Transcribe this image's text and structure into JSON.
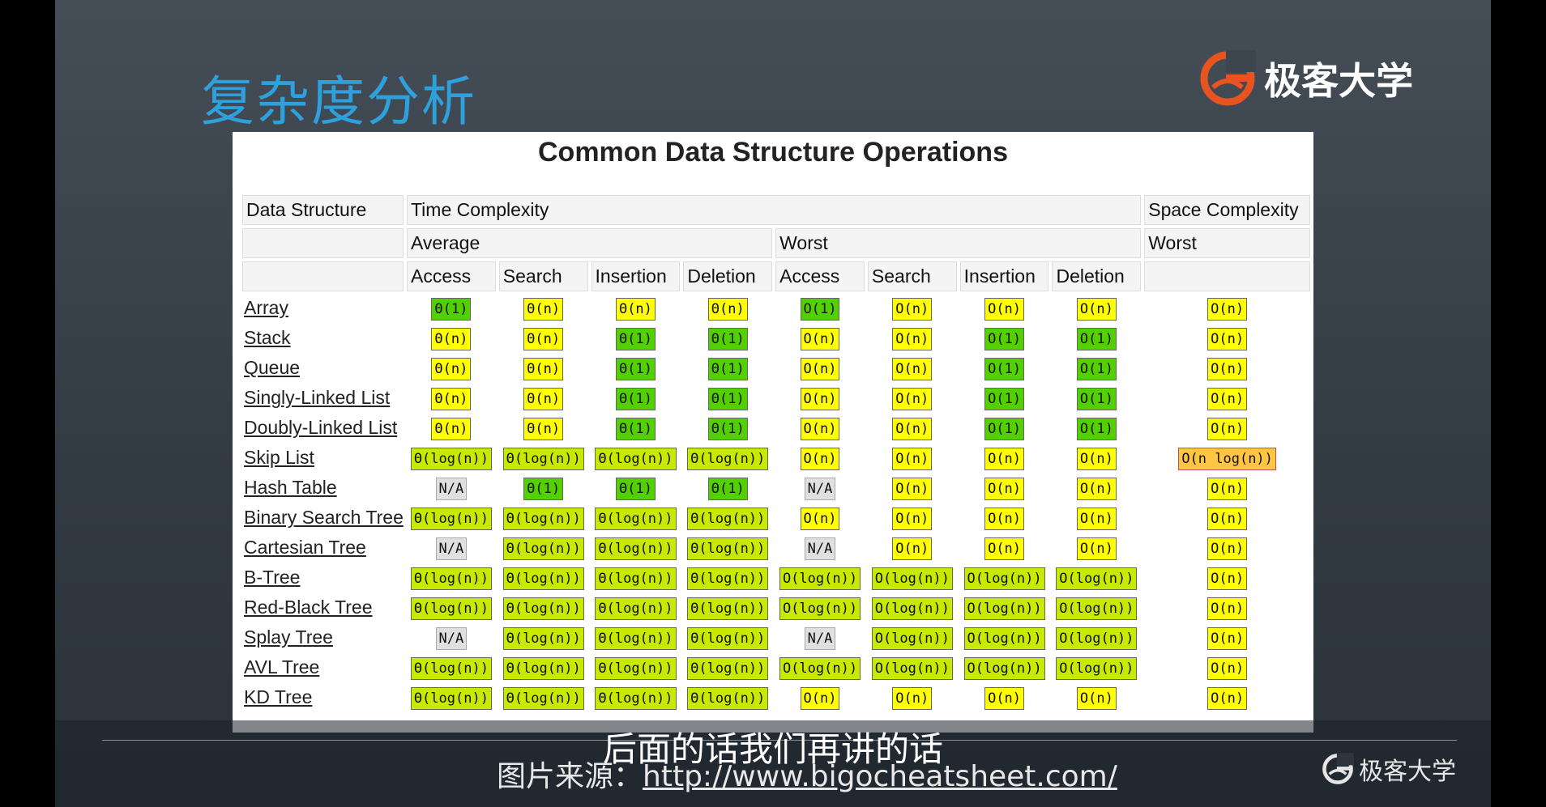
{
  "slide": {
    "title": "复杂度分析",
    "brand": "极客大学",
    "watermark": "极客大学",
    "subtitle": "后面的话我们再讲的话",
    "source_label": "图片来源：",
    "source_url": "http://www.bigocheatsheet.com/"
  },
  "table": {
    "title": "Common Data Structure Operations",
    "headers": {
      "data_structure": "Data Structure",
      "time_complexity": "Time Complexity",
      "space_complexity": "Space Complexity",
      "average": "Average",
      "worst": "Worst",
      "space_worst": "Worst",
      "ops": [
        "Access",
        "Search",
        "Insertion",
        "Deletion",
        "Access",
        "Search",
        "Insertion",
        "Deletion"
      ]
    },
    "rows": [
      {
        "name": "Array",
        "cells": [
          [
            "Θ(1)",
            "green"
          ],
          [
            "Θ(n)",
            "yellow"
          ],
          [
            "Θ(n)",
            "yellow"
          ],
          [
            "Θ(n)",
            "yellow"
          ],
          [
            "O(1)",
            "green"
          ],
          [
            "O(n)",
            "yellow"
          ],
          [
            "O(n)",
            "yellow"
          ],
          [
            "O(n)",
            "yellow"
          ],
          [
            "O(n)",
            "yellow"
          ]
        ]
      },
      {
        "name": "Stack",
        "cells": [
          [
            "Θ(n)",
            "yellow"
          ],
          [
            "Θ(n)",
            "yellow"
          ],
          [
            "Θ(1)",
            "green"
          ],
          [
            "Θ(1)",
            "green"
          ],
          [
            "O(n)",
            "yellow"
          ],
          [
            "O(n)",
            "yellow"
          ],
          [
            "O(1)",
            "green"
          ],
          [
            "O(1)",
            "green"
          ],
          [
            "O(n)",
            "yellow"
          ]
        ]
      },
      {
        "name": "Queue",
        "cells": [
          [
            "Θ(n)",
            "yellow"
          ],
          [
            "Θ(n)",
            "yellow"
          ],
          [
            "Θ(1)",
            "green"
          ],
          [
            "Θ(1)",
            "green"
          ],
          [
            "O(n)",
            "yellow"
          ],
          [
            "O(n)",
            "yellow"
          ],
          [
            "O(1)",
            "green"
          ],
          [
            "O(1)",
            "green"
          ],
          [
            "O(n)",
            "yellow"
          ]
        ]
      },
      {
        "name": "Singly-Linked List",
        "cells": [
          [
            "Θ(n)",
            "yellow"
          ],
          [
            "Θ(n)",
            "yellow"
          ],
          [
            "Θ(1)",
            "green"
          ],
          [
            "Θ(1)",
            "green"
          ],
          [
            "O(n)",
            "yellow"
          ],
          [
            "O(n)",
            "yellow"
          ],
          [
            "O(1)",
            "green"
          ],
          [
            "O(1)",
            "green"
          ],
          [
            "O(n)",
            "yellow"
          ]
        ]
      },
      {
        "name": "Doubly-Linked List",
        "cells": [
          [
            "Θ(n)",
            "yellow"
          ],
          [
            "Θ(n)",
            "yellow"
          ],
          [
            "Θ(1)",
            "green"
          ],
          [
            "Θ(1)",
            "green"
          ],
          [
            "O(n)",
            "yellow"
          ],
          [
            "O(n)",
            "yellow"
          ],
          [
            "O(1)",
            "green"
          ],
          [
            "O(1)",
            "green"
          ],
          [
            "O(n)",
            "yellow"
          ]
        ]
      },
      {
        "name": "Skip List",
        "cells": [
          [
            "Θ(log(n))",
            "lime"
          ],
          [
            "Θ(log(n))",
            "lime"
          ],
          [
            "Θ(log(n))",
            "lime"
          ],
          [
            "Θ(log(n))",
            "lime"
          ],
          [
            "O(n)",
            "yellow"
          ],
          [
            "O(n)",
            "yellow"
          ],
          [
            "O(n)",
            "yellow"
          ],
          [
            "O(n)",
            "yellow"
          ],
          [
            "O(n log(n))",
            "orange"
          ]
        ]
      },
      {
        "name": "Hash Table",
        "cells": [
          [
            "N/A",
            "gray"
          ],
          [
            "Θ(1)",
            "green"
          ],
          [
            "Θ(1)",
            "green"
          ],
          [
            "Θ(1)",
            "green"
          ],
          [
            "N/A",
            "gray"
          ],
          [
            "O(n)",
            "yellow"
          ],
          [
            "O(n)",
            "yellow"
          ],
          [
            "O(n)",
            "yellow"
          ],
          [
            "O(n)",
            "yellow"
          ]
        ]
      },
      {
        "name": "Binary Search Tree",
        "cells": [
          [
            "Θ(log(n))",
            "lime"
          ],
          [
            "Θ(log(n))",
            "lime"
          ],
          [
            "Θ(log(n))",
            "lime"
          ],
          [
            "Θ(log(n))",
            "lime"
          ],
          [
            "O(n)",
            "yellow"
          ],
          [
            "O(n)",
            "yellow"
          ],
          [
            "O(n)",
            "yellow"
          ],
          [
            "O(n)",
            "yellow"
          ],
          [
            "O(n)",
            "yellow"
          ]
        ]
      },
      {
        "name": "Cartesian Tree",
        "cells": [
          [
            "N/A",
            "gray"
          ],
          [
            "Θ(log(n))",
            "lime"
          ],
          [
            "Θ(log(n))",
            "lime"
          ],
          [
            "Θ(log(n))",
            "lime"
          ],
          [
            "N/A",
            "gray"
          ],
          [
            "O(n)",
            "yellow"
          ],
          [
            "O(n)",
            "yellow"
          ],
          [
            "O(n)",
            "yellow"
          ],
          [
            "O(n)",
            "yellow"
          ]
        ]
      },
      {
        "name": "B-Tree",
        "cells": [
          [
            "Θ(log(n))",
            "lime"
          ],
          [
            "Θ(log(n))",
            "lime"
          ],
          [
            "Θ(log(n))",
            "lime"
          ],
          [
            "Θ(log(n))",
            "lime"
          ],
          [
            "O(log(n))",
            "lime"
          ],
          [
            "O(log(n))",
            "lime"
          ],
          [
            "O(log(n))",
            "lime"
          ],
          [
            "O(log(n))",
            "lime"
          ],
          [
            "O(n)",
            "yellow"
          ]
        ]
      },
      {
        "name": "Red-Black Tree",
        "cells": [
          [
            "Θ(log(n))",
            "lime"
          ],
          [
            "Θ(log(n))",
            "lime"
          ],
          [
            "Θ(log(n))",
            "lime"
          ],
          [
            "Θ(log(n))",
            "lime"
          ],
          [
            "O(log(n))",
            "lime"
          ],
          [
            "O(log(n))",
            "lime"
          ],
          [
            "O(log(n))",
            "lime"
          ],
          [
            "O(log(n))",
            "lime"
          ],
          [
            "O(n)",
            "yellow"
          ]
        ]
      },
      {
        "name": "Splay Tree",
        "cells": [
          [
            "N/A",
            "gray"
          ],
          [
            "Θ(log(n))",
            "lime"
          ],
          [
            "Θ(log(n))",
            "lime"
          ],
          [
            "Θ(log(n))",
            "lime"
          ],
          [
            "N/A",
            "gray"
          ],
          [
            "O(log(n))",
            "lime"
          ],
          [
            "O(log(n))",
            "lime"
          ],
          [
            "O(log(n))",
            "lime"
          ],
          [
            "O(n)",
            "yellow"
          ]
        ]
      },
      {
        "name": "AVL Tree",
        "cells": [
          [
            "Θ(log(n))",
            "lime"
          ],
          [
            "Θ(log(n))",
            "lime"
          ],
          [
            "Θ(log(n))",
            "lime"
          ],
          [
            "Θ(log(n))",
            "lime"
          ],
          [
            "O(log(n))",
            "lime"
          ],
          [
            "O(log(n))",
            "lime"
          ],
          [
            "O(log(n))",
            "lime"
          ],
          [
            "O(log(n))",
            "lime"
          ],
          [
            "O(n)",
            "yellow"
          ]
        ]
      },
      {
        "name": "KD Tree",
        "cells": [
          [
            "Θ(log(n))",
            "lime"
          ],
          [
            "Θ(log(n))",
            "lime"
          ],
          [
            "Θ(log(n))",
            "lime"
          ],
          [
            "Θ(log(n))",
            "lime"
          ],
          [
            "O(n)",
            "yellow"
          ],
          [
            "O(n)",
            "yellow"
          ],
          [
            "O(n)",
            "yellow"
          ],
          [
            "O(n)",
            "yellow"
          ],
          [
            "O(n)",
            "yellow"
          ]
        ]
      }
    ]
  },
  "colors": {
    "green": "#53d000",
    "lime": "#c8ea00",
    "yellow": "#ffff00",
    "orange": "#ffc543",
    "gray": "#e0e0e0",
    "title_blue": "#2ea0dc",
    "brand_orange": "#e8531f"
  },
  "icons": {
    "brand_logo": "geek-university-logo-icon",
    "watermark_logo": "geek-university-logo-icon"
  }
}
